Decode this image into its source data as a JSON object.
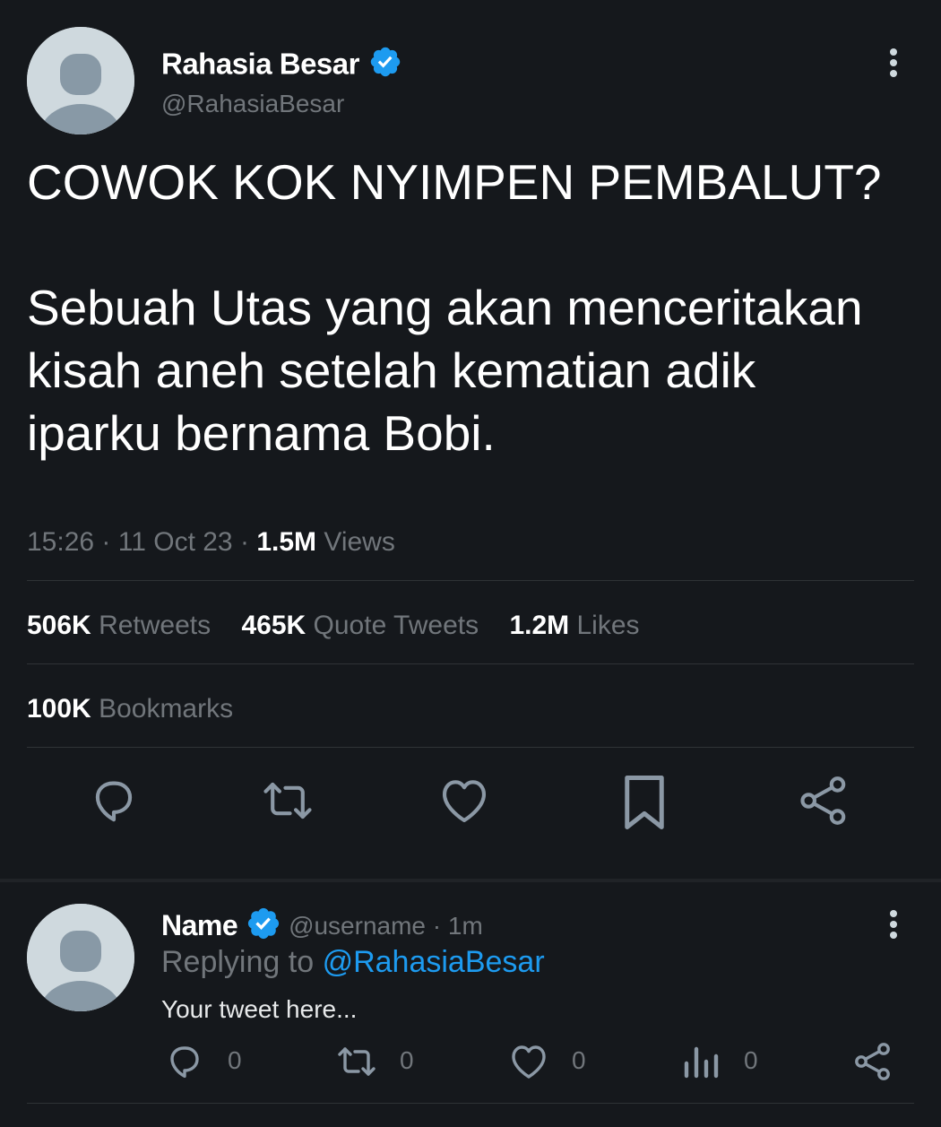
{
  "tweet": {
    "display_name": "Rahasia Besar",
    "handle": "@RahasiaBesar",
    "text_line1": "COWOK KOK NYIMPEN PEMBALUT?",
    "text_line2": "Sebuah Utas yang akan menceritakan",
    "text_line3": "kisah aneh setelah kematian adik",
    "text_line4": "iparku bernama Bobi.",
    "time": "15:26",
    "sep1": "·",
    "date": "11 Oct 23",
    "sep2": "·",
    "views_count": "1.5M",
    "views_label": "Views",
    "retweets_count": "506K",
    "retweets_label": "Retweets",
    "quotes_count": "465K",
    "quotes_label": "Quote Tweets",
    "likes_count": "1.2M",
    "likes_label": "Likes",
    "bookmarks_count": "100K",
    "bookmarks_label": "Bookmarks"
  },
  "reply": {
    "display_name": "Name",
    "handle_time": "@username · 1m",
    "replying_prefix": "Replying to",
    "replying_handle": "@RahasiaBesar",
    "text": "Your tweet here...",
    "reply_count": "0",
    "retweet_count": "0",
    "like_count": "0",
    "views_count": "0"
  },
  "colors": {
    "background": "#15181c",
    "text": "#e7e9ea",
    "muted": "#71767b",
    "accent": "#1d9bf0",
    "divider": "#2f3336"
  },
  "icons": {
    "more": "more-vertical-icon",
    "verified": "verified-badge-icon",
    "reply": "reply-icon",
    "retweet": "retweet-icon",
    "like": "heart-icon",
    "bookmark": "bookmark-icon",
    "share": "share-icon",
    "views": "views-icon"
  }
}
